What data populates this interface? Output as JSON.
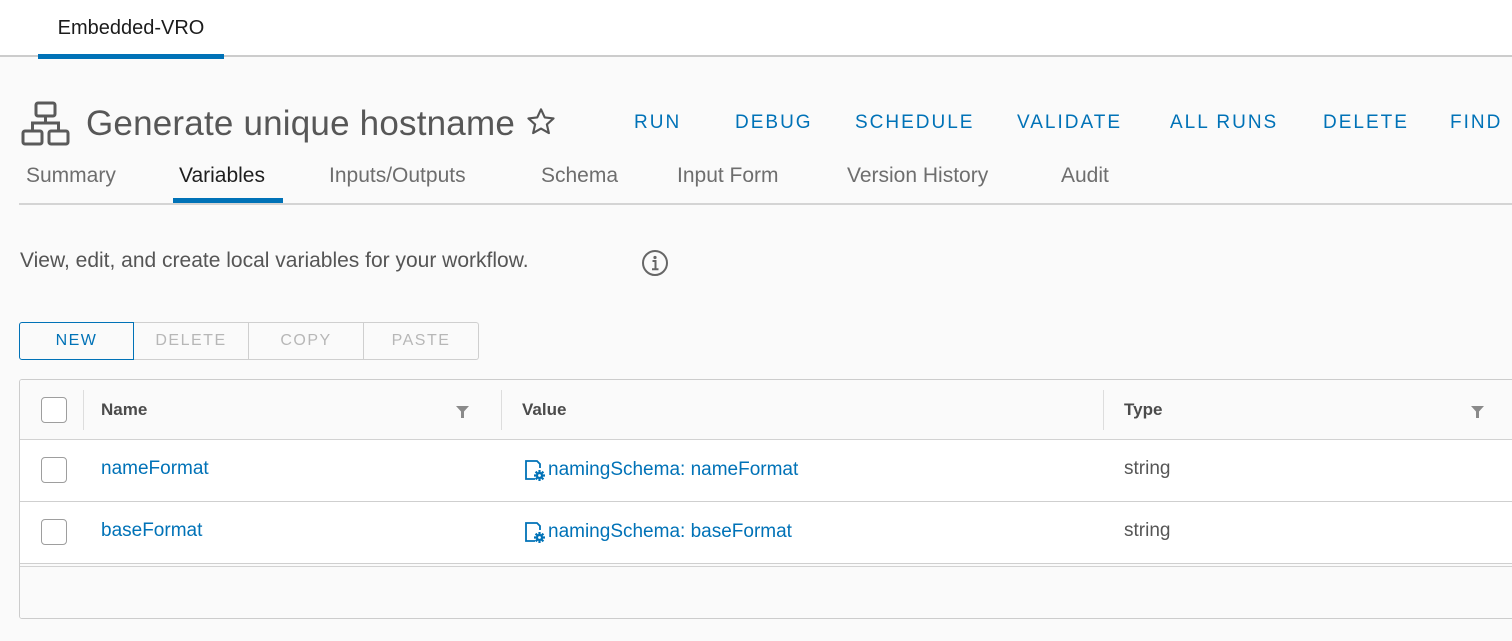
{
  "app_tabs": [
    {
      "label": "Embedded-VRO",
      "active": true
    }
  ],
  "header": {
    "title": "Generate unique hostname",
    "icon": "workflow-icon",
    "favorite_icon": "star-outline-icon",
    "actions": [
      "RUN",
      "DEBUG",
      "SCHEDULE",
      "VALIDATE",
      "ALL RUNS",
      "DELETE",
      "FIND"
    ]
  },
  "tabs": [
    {
      "label": "Summary",
      "active": false
    },
    {
      "label": "Variables",
      "active": true
    },
    {
      "label": "Inputs/Outputs",
      "active": false
    },
    {
      "label": "Schema",
      "active": false
    },
    {
      "label": "Input Form",
      "active": false
    },
    {
      "label": "Version History",
      "active": false
    },
    {
      "label": "Audit",
      "active": false
    }
  ],
  "description": "View, edit, and create local variables for your workflow.",
  "toolbar": {
    "new_label": "NEW",
    "delete_label": "DELETE",
    "copy_label": "COPY",
    "paste_label": "PASTE"
  },
  "grid": {
    "columns": [
      "Name",
      "Value",
      "Type"
    ],
    "rows": [
      {
        "name": "nameFormat",
        "value": "namingSchema: nameFormat",
        "type": "string",
        "selected": false
      },
      {
        "name": "baseFormat",
        "value": "namingSchema: baseFormat",
        "type": "string",
        "selected": false
      }
    ]
  },
  "colors": {
    "accent": "#0072b7",
    "text": "#565656",
    "background": "#fafafa"
  }
}
